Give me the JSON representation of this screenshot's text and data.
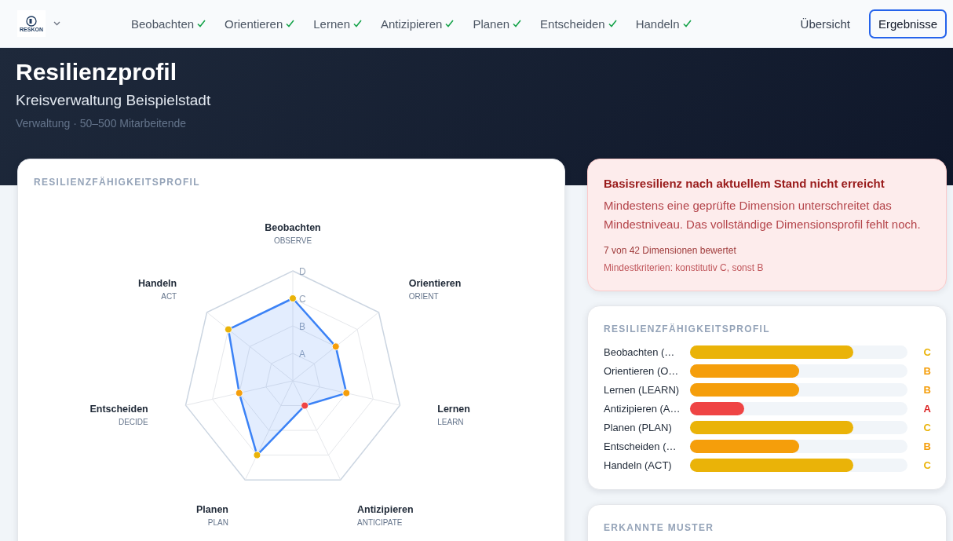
{
  "header": {
    "logo_text": "RESKON",
    "steps": [
      {
        "label": "Beobachten",
        "done": true
      },
      {
        "label": "Orientieren",
        "done": true
      },
      {
        "label": "Lernen",
        "done": true
      },
      {
        "label": "Antizipieren",
        "done": true
      },
      {
        "label": "Planen",
        "done": true
      },
      {
        "label": "Entscheiden",
        "done": true
      },
      {
        "label": "Handeln",
        "done": true
      }
    ],
    "views": [
      {
        "label": "Übersicht",
        "selected": false
      },
      {
        "label": "Ergebnisse",
        "selected": true
      }
    ]
  },
  "hero": {
    "title": "Resilienzprofil",
    "organization": "Kreisverwaltung Beispielstadt",
    "meta": "Verwaltung · 50–500 Mitarbeitende"
  },
  "radar_card": {
    "title": "RESILIENZFÄHIGKEITSPROFIL",
    "axis_codes": [
      "OBSERVE",
      "ORIENT",
      "LEARN",
      "ANTICIPATE",
      "PLAN",
      "DECIDE",
      "ACT"
    ],
    "chart_data": {
      "type": "radar",
      "categories": [
        "Beobachten",
        "Orientieren",
        "Lernen",
        "Antizipieren",
        "Planen",
        "Entscheiden",
        "Handeln"
      ],
      "values": [
        3,
        2,
        2,
        1,
        3,
        2,
        3
      ],
      "ylim": [
        0,
        4
      ],
      "yticks": [
        {
          "value": 1,
          "label": "A"
        },
        {
          "value": 2,
          "label": "B"
        },
        {
          "value": 3,
          "label": "C"
        },
        {
          "value": 4,
          "label": "D"
        }
      ]
    }
  },
  "alert": {
    "title": "Basisresilienz nach aktuellem Stand nicht erreicht",
    "message": "Mindestens eine geprüfte Dimension unterschreitet das Mindestniveau. Das vollständige Dimensionsprofil fehlt noch.",
    "progress": "7 von 42 Dimensionen bewertet",
    "criteria": "Mindestkriterien: konstitutiv C, sonst B"
  },
  "profile_card": {
    "title": "RESILIENZFÄHIGKEITSPROFIL",
    "rows": [
      {
        "label": "Beobachten (…",
        "level": 0.75,
        "grade": "C",
        "color": "#eab308"
      },
      {
        "label": "Orientieren (O…",
        "level": 0.5,
        "grade": "B",
        "color": "#f59e0b"
      },
      {
        "label": "Lernen (LEARN)",
        "level": 0.5,
        "grade": "B",
        "color": "#f59e0b"
      },
      {
        "label": "Antizipieren (A…",
        "level": 0.25,
        "grade": "A",
        "color": "#ef4444"
      },
      {
        "label": "Planen (PLAN)",
        "level": 0.75,
        "grade": "C",
        "color": "#eab308"
      },
      {
        "label": "Entscheiden (…",
        "level": 0.5,
        "grade": "B",
        "color": "#f59e0b"
      },
      {
        "label": "Handeln (ACT)",
        "level": 0.75,
        "grade": "C",
        "color": "#eab308"
      }
    ]
  },
  "patterns_card": {
    "title": "ERKANNTE MUSTER"
  }
}
